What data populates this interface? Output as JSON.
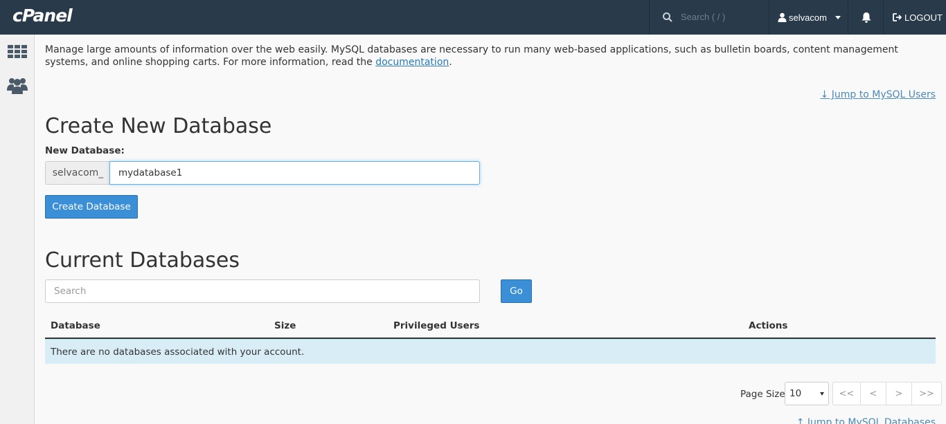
{
  "topbar": {
    "logo": "cPanel",
    "search_placeholder": "Search ( / )",
    "username": "selvacom",
    "logout_label": "LOGOUT"
  },
  "intro": {
    "text": "Manage large amounts of information over the web easily. MySQL databases are necessary to run many web-based applications, such as bulletin boards, content management systems, and online shopping carts. For more information, read the ",
    "link_text": "documentation",
    "suffix": "."
  },
  "jump_users": "↓ Jump to MySQL Users",
  "create": {
    "heading": "Create New Database",
    "label": "New Database:",
    "prefix": "selvacom_",
    "value": "mydatabase1",
    "button": "Create Database"
  },
  "current": {
    "heading": "Current Databases",
    "search_placeholder": "Search",
    "go_label": "Go",
    "columns": [
      "Database",
      "Size",
      "Privileged Users",
      "Actions"
    ],
    "empty_message": "There are no databases associated with your account."
  },
  "pagination": {
    "page_size_label": "Page Size",
    "page_size": "10",
    "buttons": [
      "<<",
      "<",
      ">",
      ">>"
    ]
  },
  "jump_db": "↑ Jump to MySQL Databases"
}
